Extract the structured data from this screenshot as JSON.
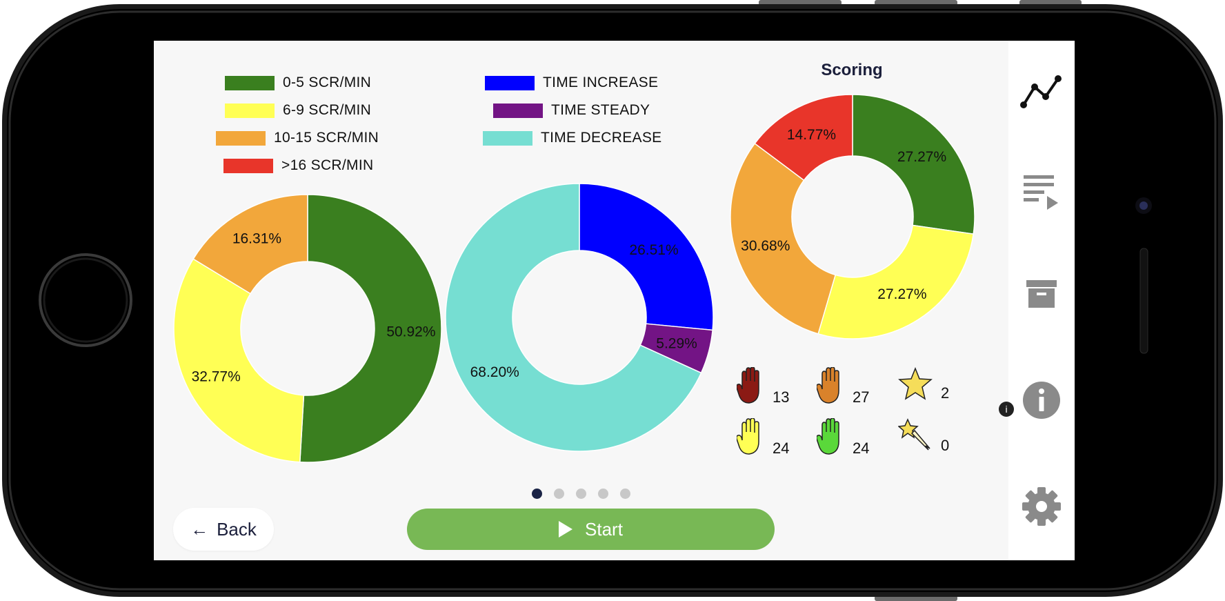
{
  "legend_scroll": [
    {
      "label": "0-5 SCR/MIN",
      "color": "#3a7f1f"
    },
    {
      "label": "6-9 SCR/MIN",
      "color": "#ffff55"
    },
    {
      "label": "10-15 SCR/MIN",
      "color": "#f2a73b"
    },
    {
      "label": ">16 SCR/MIN",
      "color": "#e8352a"
    }
  ],
  "legend_time": [
    {
      "label": "TIME INCREASE",
      "color": "#0000ff"
    },
    {
      "label": "TIME STEADY",
      "color": "#731485"
    },
    {
      "label": "TIME DECREASE",
      "color": "#76ded2"
    }
  ],
  "scoring": {
    "title": "Scoring",
    "items": [
      {
        "icon": "red-hand-icon",
        "value": "13",
        "color": "#8b1a14"
      },
      {
        "icon": "orange-hand-icon",
        "value": "27",
        "color": "#d9822b"
      },
      {
        "icon": "star-icon",
        "value": "2",
        "color": "#f5dd5a"
      },
      {
        "icon": "yellow-hand-icon",
        "value": "24",
        "color": "#ffff55"
      },
      {
        "icon": "green-hand-icon",
        "value": "24",
        "color": "#5ad83a"
      },
      {
        "icon": "shooting-star-icon",
        "value": "0",
        "color": "#f5dd5a"
      }
    ]
  },
  "chart_data": [
    {
      "type": "pie",
      "variant": "donut",
      "slices": [
        {
          "name": "0-5 SCR/MIN",
          "value": 50.92,
          "label": "50.92%",
          "color": "#3a7f1f"
        },
        {
          "name": "6-9 SCR/MIN",
          "value": 32.77,
          "label": "32.77%",
          "color": "#ffff55"
        },
        {
          "name": "10-15 SCR/MIN",
          "value": 16.31,
          "label": "16.31%",
          "color": "#f2a73b"
        }
      ]
    },
    {
      "type": "pie",
      "variant": "donut",
      "slices": [
        {
          "name": "TIME INCREASE",
          "value": 26.51,
          "label": "26.51%",
          "color": "#0000ff"
        },
        {
          "name": "TIME STEADY",
          "value": 5.29,
          "label": "5.29%",
          "color": "#731485"
        },
        {
          "name": "TIME DECREASE",
          "value": 68.2,
          "label": "68.20%",
          "color": "#76ded2"
        }
      ]
    },
    {
      "type": "pie",
      "variant": "donut",
      "title": "Scoring",
      "slices": [
        {
          "name": "green",
          "value": 27.27,
          "label": "27.27%",
          "color": "#3a7f1f"
        },
        {
          "name": "yellow",
          "value": 27.27,
          "label": "27.27%",
          "color": "#ffff55"
        },
        {
          "name": "orange",
          "value": 30.68,
          "label": "30.68%",
          "color": "#f2a73b"
        },
        {
          "name": "red",
          "value": 14.77,
          "label": "14.77%",
          "color": "#e8352a"
        }
      ]
    }
  ],
  "pagination": {
    "count": 5,
    "active": 0
  },
  "buttons": {
    "back": "Back",
    "back_arrow": "←",
    "start": "Start"
  },
  "sidebar": {
    "items": [
      {
        "icon": "line-chart-icon"
      },
      {
        "icon": "playlist-icon"
      },
      {
        "icon": "archive-icon"
      },
      {
        "icon": "info-icon"
      },
      {
        "icon": "settings-icon"
      }
    ]
  },
  "info_badge": "i"
}
